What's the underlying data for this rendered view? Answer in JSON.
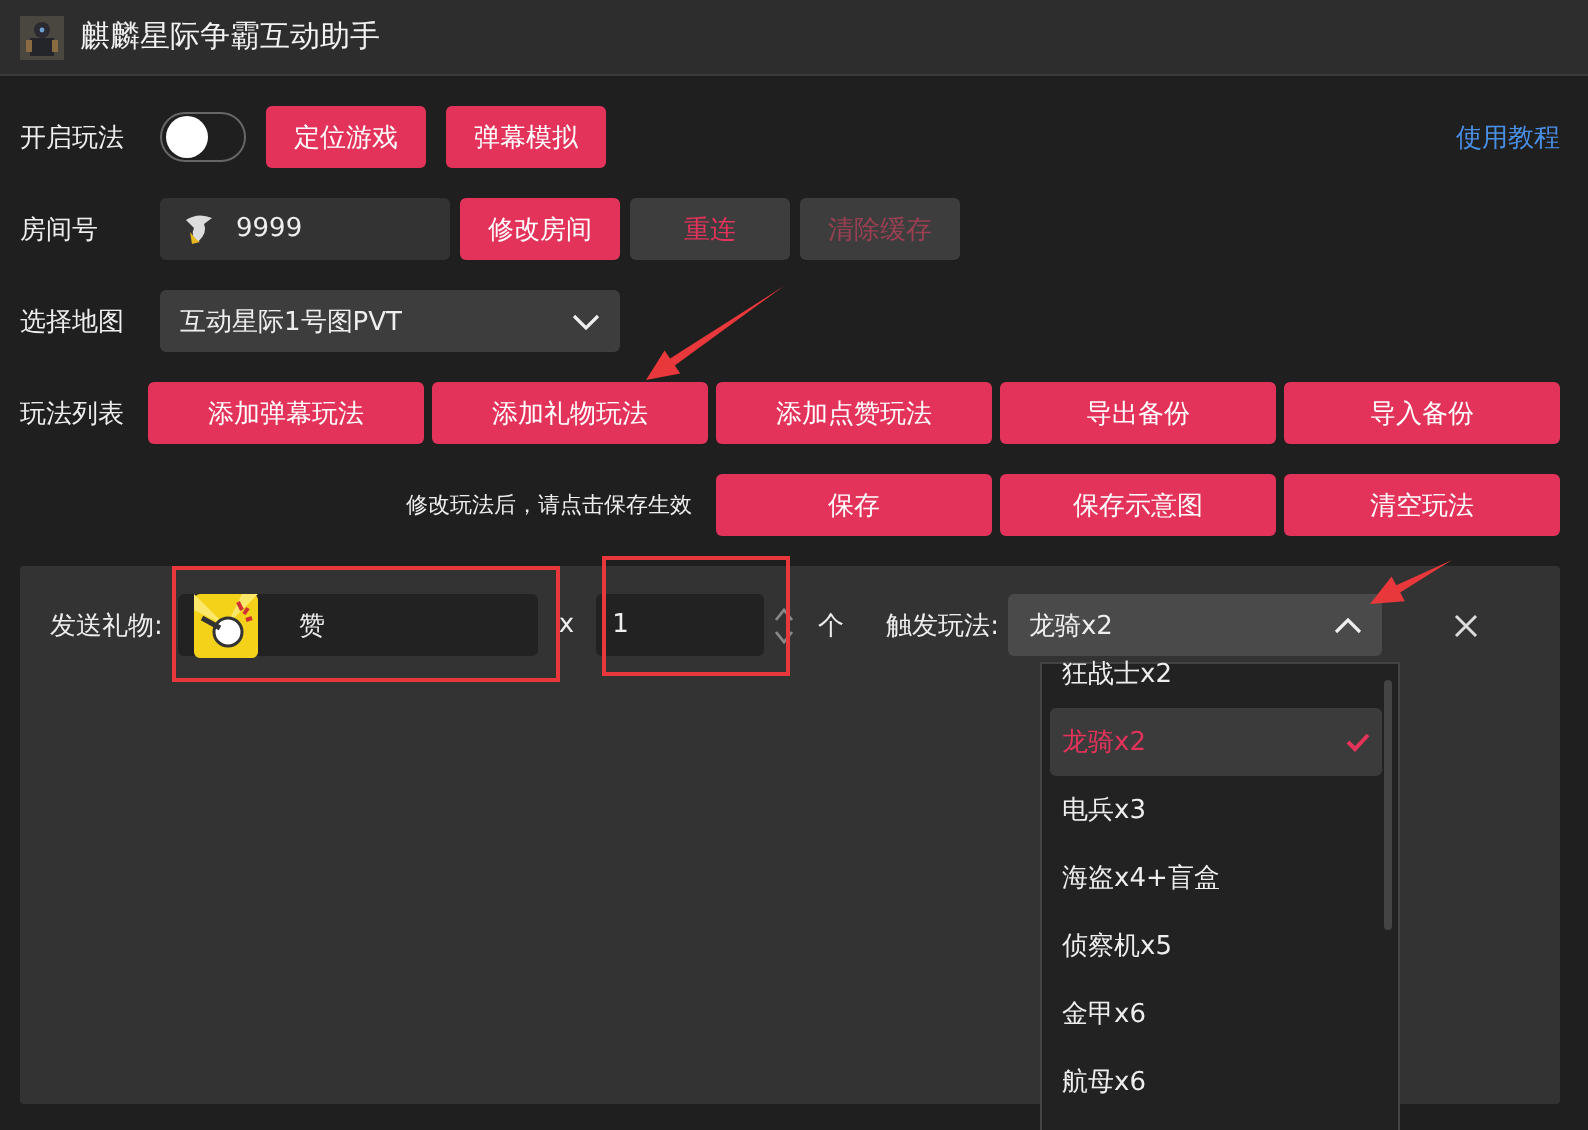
{
  "window": {
    "title": "麒麟星际争霸互动助手"
  },
  "toggle_row": {
    "label": "开启玩法",
    "on": false,
    "buttons": [
      "定位游戏",
      "弹幕模拟"
    ],
    "help_link": "使用教程"
  },
  "room": {
    "label": "房间号",
    "value": "9999",
    "buttons": [
      {
        "label": "修改房间",
        "kind": "primary"
      },
      {
        "label": "重连",
        "kind": "secondary"
      },
      {
        "label": "清除缓存",
        "kind": "disabled"
      }
    ]
  },
  "map": {
    "label": "选择地图",
    "value": "互动星际1号图PVT"
  },
  "play_list": {
    "label": "玩法列表",
    "buttons": [
      "添加弹幕玩法",
      "添加礼物玩法",
      "添加点赞玩法",
      "导出备份",
      "导入备份"
    ],
    "hint": "修改玩法后，请点击保存生效",
    "save_buttons": [
      "保存",
      "保存示意图",
      "清空玩法"
    ]
  },
  "rule": {
    "gift_label": "发送礼物:",
    "gift": "赞",
    "times_sign": "x",
    "count": "1",
    "unit": "个",
    "trigger_label": "触发玩法:",
    "trigger_value": "龙骑x2",
    "expanded": true,
    "options": [
      {
        "label": "狂战士x2",
        "selected": false
      },
      {
        "label": "龙骑x2",
        "selected": true
      },
      {
        "label": "电兵x3",
        "selected": false
      },
      {
        "label": "海盗x4+盲盒",
        "selected": false
      },
      {
        "label": "侦察机x5",
        "selected": false
      },
      {
        "label": "金甲x6",
        "selected": false
      },
      {
        "label": "航母x6",
        "selected": false
      }
    ]
  }
}
